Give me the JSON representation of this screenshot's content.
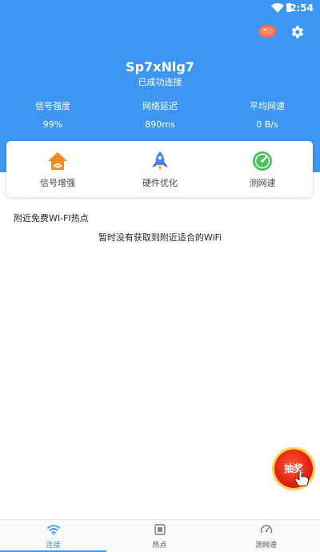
{
  "status_bar": {
    "time": "2:54"
  },
  "network": {
    "ssid": "Sp7xNlg7",
    "status": "已成功连接"
  },
  "stats": [
    {
      "label": "信号强度",
      "value": "99%"
    },
    {
      "label": "网络延迟",
      "value": "890ms"
    },
    {
      "label": "平均网速",
      "value": "0 B/s"
    }
  ],
  "features": [
    {
      "label": "信号增强",
      "icon": "house-signal-icon"
    },
    {
      "label": "硬件优化",
      "icon": "rocket-icon"
    },
    {
      "label": "测网速",
      "icon": "speedometer-icon"
    }
  ],
  "hotspots": {
    "title": "附近免费WI-FI热点",
    "empty_message": "暂时没有获取到附近适合的WiFi"
  },
  "lottery": {
    "label": "抽奖"
  },
  "tabs": [
    {
      "label": "连接",
      "icon": "wifi-icon",
      "active": true
    },
    {
      "label": "热点",
      "icon": "hotspot-icon",
      "active": false
    },
    {
      "label": "测网速",
      "icon": "speed-test-icon",
      "active": false
    }
  ],
  "colors": {
    "primary": "#3d97f2",
    "lottery_red": "#e21f10",
    "feature_orange": "#f08a24",
    "feature_green": "#4cc05a"
  }
}
